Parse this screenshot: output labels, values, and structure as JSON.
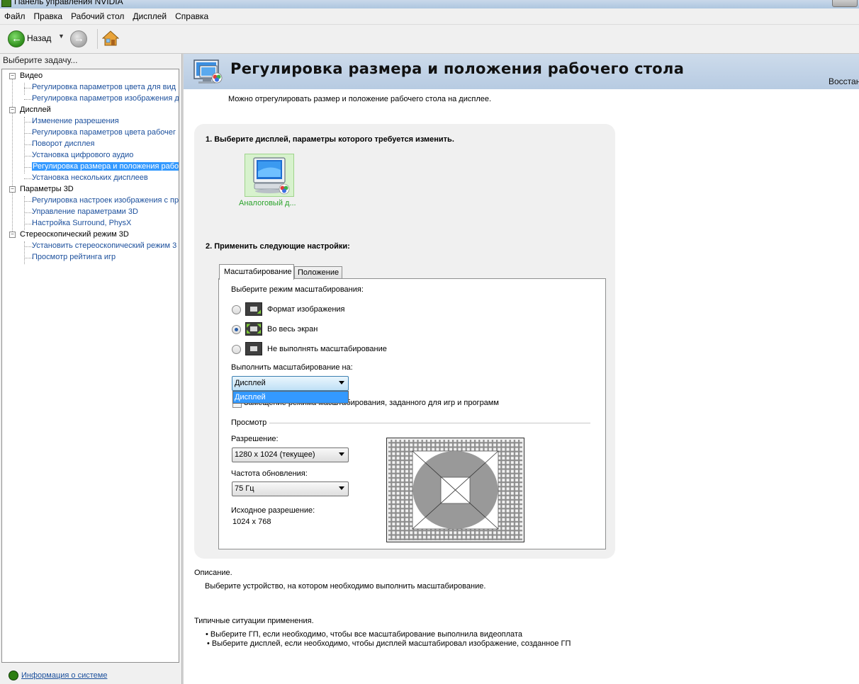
{
  "window": {
    "title": "Панель управления NVIDIA"
  },
  "menu": [
    "Файл",
    "Правка",
    "Рабочий стол",
    "Дисплей",
    "Справка"
  ],
  "toolbar": {
    "back_label": "Назад"
  },
  "sidebar": {
    "task_label": "Выберите задачу...",
    "categories": [
      {
        "label": "Видео",
        "items": [
          "Регулировка параметров цвета для вид",
          "Регулировка параметров изображения д"
        ]
      },
      {
        "label": "Дисплей",
        "items": [
          "Изменение разрешения",
          "Регулировка параметров цвета рабочег",
          "Поворот дисплея",
          "Установка цифрового аудио",
          "Регулировка размера и положения рабо",
          "Установка нескольких дисплеев"
        ]
      },
      {
        "label": "Параметры 3D",
        "items": [
          "Регулировка настроек изображения с пр",
          "Управление параметрами 3D",
          "Настройка Surround, PhysX"
        ]
      },
      {
        "label": "Стереоскопический режим 3D",
        "items": [
          "Установить стереоскопический режим 3",
          "Просмотр рейтинга игр"
        ]
      }
    ],
    "selected": "Регулировка размера и положения рабо",
    "system_info": "Информация о системе"
  },
  "header": {
    "title": "Регулировка размера и положения рабочего стола",
    "restore": "Восстан"
  },
  "intro": "Можно отрегулировать размер и положение рабочего стола на дисплее.",
  "step1": {
    "label": "1. Выберите дисплей, параметры которого требуется изменить.",
    "display_name": "Аналоговый д..."
  },
  "step2": {
    "label": "2. Применить следующие настройки:",
    "tabs": [
      "Масштабирование",
      "Положение"
    ],
    "active_tab": "Масштабирование",
    "mode_label": "Выберите режим масштабирования:",
    "modes": [
      {
        "label": "Формат изображения",
        "selected": false
      },
      {
        "label": "Во весь экран",
        "selected": true
      },
      {
        "label": "Не выполнять масштабирование",
        "selected": false
      }
    ],
    "perform_on_label": "Выполнить масштабирование на:",
    "perform_on_value": "Дисплей",
    "perform_on_options": [
      "Дисплей"
    ],
    "override_text": "Замещение режима масштабирования, заданного для игр и программ",
    "override_checked": false,
    "preview_label": "Просмотр",
    "resolution_label": "Разрешение:",
    "resolution_value": "1280 x 1024 (текущее)",
    "refresh_label": "Частота обновления:",
    "refresh_value": "75 Гц",
    "native_label": "Исходное разрешение:",
    "native_value": "1024 x 768"
  },
  "description": {
    "title": "Описание.",
    "text": "Выберите устройство, на котором необходимо выполнить масштабирование."
  },
  "usage": {
    "title": "Типичные ситуации применения.",
    "items": [
      "• Выберите ГП, если необходимо, чтобы все масштабирование выполнила видеоплата",
      "• Выберите дисплей, если необходимо, чтобы дисплей масштабировал изображение, созданное ГП"
    ]
  },
  "colors": {
    "header_band": "#c3d4e8",
    "selection": "#3399ff",
    "link": "#1b4f9c",
    "display_label": "#2ba32b"
  }
}
